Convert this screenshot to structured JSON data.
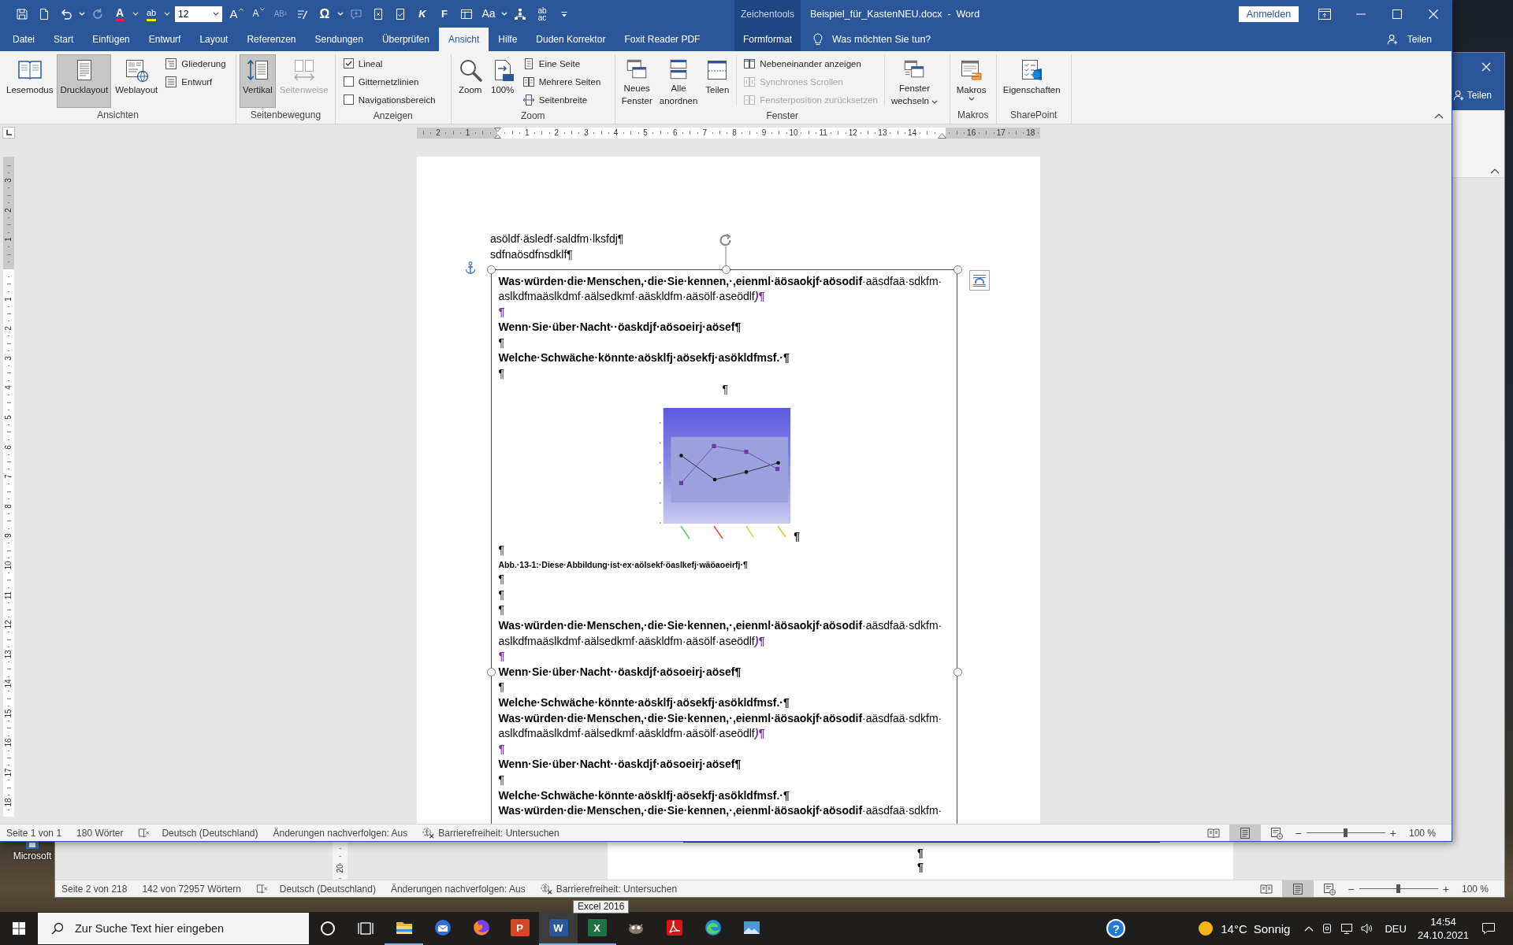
{
  "window": {
    "context_group": "Zeichentools",
    "title": "Beispiel_für_KastenNEU.docx  -  Word",
    "sign_in": "Anmelden"
  },
  "quick_access": {
    "items": [
      {
        "kind": "icon",
        "disabled": false
      },
      {
        "kind": "icon",
        "disabled": false
      },
      {
        "kind": "icon",
        "disabled": false
      },
      {
        "kind": "caret",
        "disabled": false
      },
      {
        "kind": "icon",
        "disabled": true
      },
      {
        "kind": "glyph",
        "glyph": "A",
        "disabled": false
      },
      {
        "kind": "caret",
        "disabled": false
      },
      {
        "kind": "glyph",
        "glyph": "ab",
        "disabled": false
      },
      {
        "kind": "caret",
        "disabled": false
      },
      {
        "kind": "field",
        "value": "12",
        "disabled": false,
        "dropdown": true
      },
      {
        "kind": "glyph",
        "glyph": "A",
        "disabled": false
      },
      {
        "kind": "glyph",
        "glyph": "A",
        "disabled": false
      },
      {
        "kind": "glyph",
        "glyph": "AB¹",
        "disabled": true
      },
      {
        "kind": "icon",
        "disabled": false
      },
      {
        "kind": "glyph",
        "glyph": "Ω",
        "disabled": false
      },
      {
        "kind": "caret",
        "disabled": false
      },
      {
        "kind": "icon",
        "disabled": true
      },
      {
        "kind": "icon",
        "disabled": false
      },
      {
        "kind": "icon",
        "disabled": false
      },
      {
        "kind": "glyph",
        "glyph": "K",
        "disabled": false
      },
      {
        "kind": "glyph",
        "glyph": "F",
        "disabled": false
      },
      {
        "kind": "icon",
        "disabled": false
      },
      {
        "kind": "glyph",
        "glyph": "Aa",
        "disabled": false
      },
      {
        "kind": "caret",
        "disabled": false
      },
      {
        "kind": "icon",
        "disabled": false
      },
      {
        "kind": "stacked",
        "lines": [
          "ab",
          "ac"
        ],
        "disabled": false
      },
      {
        "kind": "icon",
        "disabled": false
      }
    ]
  },
  "tabs": [
    {
      "label": "Datei",
      "kind": "standard",
      "selected": false
    },
    {
      "label": "Start",
      "kind": "standard",
      "selected": false
    },
    {
      "label": "Einfügen",
      "kind": "standard",
      "selected": false
    },
    {
      "label": "Entwurf",
      "kind": "standard",
      "selected": false
    },
    {
      "label": "Layout",
      "kind": "standard",
      "selected": false
    },
    {
      "label": "Referenzen",
      "kind": "standard",
      "selected": false
    },
    {
      "label": "Sendungen",
      "kind": "standard",
      "selected": false
    },
    {
      "label": "Überprüfen",
      "kind": "standard",
      "selected": false
    },
    {
      "label": "Ansicht",
      "kind": "standard",
      "selected": true
    },
    {
      "label": "Hilfe",
      "kind": "standard",
      "selected": false
    },
    {
      "label": "Duden Korrektor",
      "kind": "standard",
      "selected": false
    },
    {
      "label": "Foxit Reader PDF",
      "kind": "standard",
      "selected": false
    },
    {
      "label": "Formformat",
      "kind": "contextual",
      "selected": false
    }
  ],
  "tell_me": {
    "placeholder": "Was möchten Sie tun?"
  },
  "share": "Teilen",
  "ribbon": {
    "groups": [
      {
        "label": "Ansichten",
        "items": [
          {
            "kind": "large",
            "label": "Lesemodus",
            "selected": false,
            "disabled": false
          },
          {
            "kind": "large",
            "label": "Drucklayout",
            "selected": true,
            "disabled": false
          },
          {
            "kind": "large",
            "label": "Weblayout",
            "selected": false,
            "disabled": false
          },
          {
            "kind": "stack",
            "rows": [
              {
                "kind": "small",
                "label": "Gliederung",
                "selected": false,
                "disabled": false
              },
              {
                "kind": "small",
                "label": "Entwurf",
                "selected": false,
                "disabled": false
              }
            ]
          }
        ]
      },
      {
        "label": "Seitenbewegung",
        "items": [
          {
            "kind": "large",
            "label": "Vertikal",
            "selected": true,
            "disabled": false
          },
          {
            "kind": "large",
            "label": "Seitenweise",
            "selected": false,
            "disabled": true
          }
        ]
      },
      {
        "label": "Anzeigen",
        "items": [
          {
            "kind": "stack",
            "rows": [
              {
                "kind": "checkbox",
                "label": "Lineal",
                "checked": true
              },
              {
                "kind": "checkbox",
                "label": "Gitternetzlinien",
                "checked": false
              },
              {
                "kind": "checkbox",
                "label": "Navigationsbereich",
                "checked": false
              }
            ]
          }
        ]
      },
      {
        "label": "Zoom",
        "items": [
          {
            "kind": "large",
            "label": "Zoom",
            "selected": false,
            "disabled": false
          },
          {
            "kind": "large",
            "label": "100%",
            "selected": false,
            "disabled": false
          },
          {
            "kind": "stack",
            "rows": [
              {
                "kind": "small",
                "label": "Eine Seite",
                "selected": false,
                "disabled": false
              },
              {
                "kind": "small",
                "label": "Mehrere Seiten",
                "selected": false,
                "disabled": false
              },
              {
                "kind": "small",
                "label": "Seitenbreite",
                "selected": false,
                "disabled": false
              }
            ]
          }
        ]
      },
      {
        "label": "Fenster",
        "items": [
          {
            "kind": "large",
            "label": "Neues Fenster",
            "selected": false,
            "disabled": false
          },
          {
            "kind": "large",
            "label": "Alle anordnen",
            "selected": false,
            "disabled": false
          },
          {
            "kind": "large",
            "label": "Teilen",
            "selected": false,
            "disabled": false
          },
          {
            "kind": "separator"
          },
          {
            "kind": "stack",
            "rows": [
              {
                "kind": "small",
                "label": "Nebeneinander anzeigen",
                "selected": false,
                "disabled": false
              },
              {
                "kind": "small",
                "label": "Synchrones Scrollen",
                "selected": false,
                "disabled": true
              },
              {
                "kind": "small",
                "label": "Fensterposition zurücksetzen",
                "selected": false,
                "disabled": true
              }
            ]
          },
          {
            "kind": "separator"
          },
          {
            "kind": "large_split",
            "label": "Fenster wechseln",
            "selected": false,
            "disabled": false
          }
        ]
      },
      {
        "label": "Makros",
        "items": [
          {
            "kind": "large_menu",
            "label": "Makros",
            "selected": false,
            "disabled": false
          }
        ]
      },
      {
        "label": "SharePoint",
        "items": [
          {
            "kind": "large",
            "label": "Eigenschaften",
            "selected": false,
            "disabled": false
          }
        ]
      }
    ]
  },
  "ruler": {
    "horizontal": {
      "before_zero": [
        "2",
        "1"
      ],
      "between_indents": [
        "1",
        "2",
        "3",
        "4",
        "5",
        "6",
        "7",
        "8",
        "9",
        "10",
        "11",
        "12",
        "13",
        "14"
      ],
      "after_indent": [
        "16",
        "17",
        "18"
      ]
    },
    "vertical": {
      "before_zero": [
        "3",
        "2",
        "1"
      ],
      "after_zero": [
        "1",
        "2",
        "3",
        "4",
        "5",
        "6",
        "7",
        "8",
        "9",
        "10",
        "11",
        "12",
        "13",
        "14",
        "15",
        "16",
        "17",
        "18"
      ]
    }
  },
  "document": {
    "paragraphs": [
      {
        "kind": "body",
        "lines": [
          "asöldf·äsledf·saldfm·lksfdj¶"
        ]
      },
      {
        "kind": "body",
        "lines": [
          "sdfnaösdfnsdklf¶"
        ]
      }
    ],
    "text_box": {
      "selected": true,
      "paragraphs": [
        {
          "kind": "body",
          "lines": [
            "**Was·würden·die·Menschen,·die·Sie·kennen,·,eienml·äösaokjf·aösodif**·aäsdfaä·sdkfm·",
            "aslkdfmaäslkdmf·aälsedkmf·aäskldfm·aäsölf·aseödlf"
          ],
          "marked_end": ")¶"
        },
        {
          "kind": "revision",
          "lines": [
            "¶"
          ]
        },
        {
          "kind": "bold",
          "lines": [
            "Wenn·Sie·über·Nacht··öaskdjf·aösoeirj·aösef¶"
          ]
        },
        {
          "kind": "mark",
          "lines": [
            "¶"
          ]
        },
        {
          "kind": "bold",
          "lines": [
            "Welche·Schwäche·könnte·aösklfj·aösekfj·asökldfmsf.·¶"
          ]
        },
        {
          "kind": "mark",
          "lines": [
            "¶"
          ]
        },
        {
          "kind": "centered",
          "lines": [
            "¶"
          ]
        },
        {
          "kind": "figure",
          "lines": [
            "¶"
          ]
        },
        {
          "kind": "mark",
          "lines": [
            "¶"
          ]
        },
        {
          "kind": "caption",
          "lines": [
            "Abb.·13-1:·Diese·Abbildung·ist·ex·aölsekf·öaslkefj·wäöaoeirfj·¶"
          ]
        },
        {
          "kind": "mark",
          "lines": [
            "¶"
          ]
        },
        {
          "kind": "mark",
          "lines": [
            "¶"
          ]
        },
        {
          "kind": "mark",
          "lines": [
            "¶"
          ]
        },
        {
          "kind": "body",
          "lines": [
            "**Was·würden·die·Menschen,·die·Sie·kennen,·,eienml·äösaokjf·aösodif**·aäsdfaä·sdkfm·",
            "aslkdfmaäslkdmf·aälsedkmf·aäskldfm·aäsölf·aseödlf"
          ],
          "marked_end": ")¶"
        },
        {
          "kind": "revision",
          "lines": [
            "¶"
          ]
        },
        {
          "kind": "bold",
          "lines": [
            "Wenn·Sie·über·Nacht··öaskdjf·aösoeirj·aösef¶"
          ]
        },
        {
          "kind": "mark",
          "lines": [
            "¶"
          ]
        },
        {
          "kind": "bold",
          "lines": [
            "Welche·Schwäche·könnte·aösklfj·aösekfj·asökldfmsf.·¶"
          ]
        },
        {
          "kind": "body",
          "lines": [
            "**Was·würden·die·Menschen,·die·Sie·kennen,·,eienml·äösaokjf·aösodif**·aäsdfaä·sdkfm·",
            "aslkdfmaäslkdmf·aälsedkmf·aäskldfm·aäsölf·aseödlf"
          ],
          "marked_end": ")¶"
        },
        {
          "kind": "revision",
          "lines": [
            "¶"
          ]
        },
        {
          "kind": "bold",
          "lines": [
            "Wenn·Sie·über·Nacht··öaskdjf·aösoeirj·aösef¶"
          ]
        },
        {
          "kind": "mark",
          "lines": [
            "¶"
          ]
        },
        {
          "kind": "bold",
          "lines": [
            "Welche·Schwäche·könnte·aösklfj·aösekfj·asökldfmsf.·¶"
          ]
        },
        {
          "kind": "body",
          "lines": [
            "**Was·würden·die·Menschen,·die·Sie·kennen,·,eienml·äösaokjf·aösodif**·aäsdfaä·sdkfm·"
          ]
        }
      ]
    }
  },
  "status_bar": {
    "page": "Seite 1 von 1",
    "words": "180 Wörter",
    "language": "Deutsch (Deutschland)",
    "track_changes": "Änderungen nachverfolgen: Aus",
    "accessibility": "Barrierefreiheit: Untersuchen",
    "views": [
      {
        "selected": false
      },
      {
        "selected": true
      },
      {
        "selected": false
      }
    ],
    "zoom": {
      "out": "−",
      "in": "+",
      "level": 0.5,
      "reading": "100 %"
    }
  },
  "background_window": {
    "share": "Teilen",
    "ruler_labels": [
      "20"
    ],
    "paragraphs": [
      "¶",
      "¶"
    ],
    "status_bar": {
      "page": "Seite 2 von 218",
      "words": "142 von 72957 Wörtern",
      "language": "Deutsch (Deutschland)",
      "track_changes": "Änderungen nachverfolgen: Aus",
      "accessibility": "Barrierefreiheit: Untersuchen",
      "views": [
        {
          "selected": false
        },
        {
          "selected": true
        },
        {
          "selected": false
        }
      ],
      "zoom": {
        "out": "−",
        "in": "+",
        "level": 0.5,
        "reading": "100 %"
      }
    }
  },
  "desktop_icons": [
    {
      "label": "Microsoft"
    }
  ],
  "tooltip": "Excel 2016",
  "taskbar": {
    "search": {
      "placeholder": "Zur Suche Text hier eingeben"
    },
    "apps": [
      {
        "running": true,
        "selected": false
      },
      {
        "running": false,
        "selected": false
      },
      {
        "running": false,
        "selected": false
      },
      {
        "running": false,
        "selected": false,
        "glyph": "P"
      },
      {
        "running": true,
        "selected": true,
        "glyph": "W"
      },
      {
        "running": true,
        "selected": false,
        "glyph": "X"
      },
      {
        "running": false,
        "selected": false
      },
      {
        "running": false,
        "selected": false
      },
      {
        "running": false,
        "selected": false
      },
      {
        "running": false,
        "selected": false
      }
    ],
    "help": "?",
    "weather": {
      "temperature": "14°C",
      "condition": "Sonnig"
    },
    "language": "DEU",
    "time": "14:54",
    "date": "24.10.2021"
  }
}
